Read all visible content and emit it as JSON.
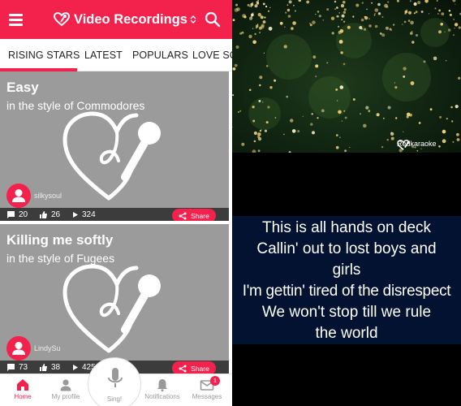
{
  "header": {
    "title": "Video Recordings",
    "title_caret": "⌃⌄",
    "menu_icon": "menu-icon",
    "search_icon": "search-icon",
    "brand_color": "#f2224d"
  },
  "tabs": [
    {
      "label": "RISING STARS",
      "active": true
    },
    {
      "label": "LATEST",
      "active": false
    },
    {
      "label": "POPULARS",
      "active": false
    },
    {
      "label": "LOVE SO",
      "active": false
    }
  ],
  "recordings": [
    {
      "title": "Easy",
      "style": "in the style of Commodores",
      "user": "silkysoul",
      "comments": "20",
      "likes": "26",
      "plays": "324",
      "share_label": "Share"
    },
    {
      "title": "Killing me softly",
      "style": "in the style of Fugees",
      "user": "LindySu",
      "comments": "73",
      "likes": "38",
      "plays": "425",
      "share_label": "Share"
    }
  ],
  "bottom_nav": {
    "home": "Home",
    "profile": "My profile",
    "sing": "Sing!",
    "notifications": "Notifications",
    "messages": "Messages",
    "messages_badge": "1"
  },
  "player": {
    "brand": "Redkaraoke",
    "lyrics": [
      "This is all hands on deck",
      "Callin' out to lost boys and",
      "girls",
      "I'm gettin' tired of the disrespect",
      "We won't stop till we rule",
      "the world"
    ]
  }
}
